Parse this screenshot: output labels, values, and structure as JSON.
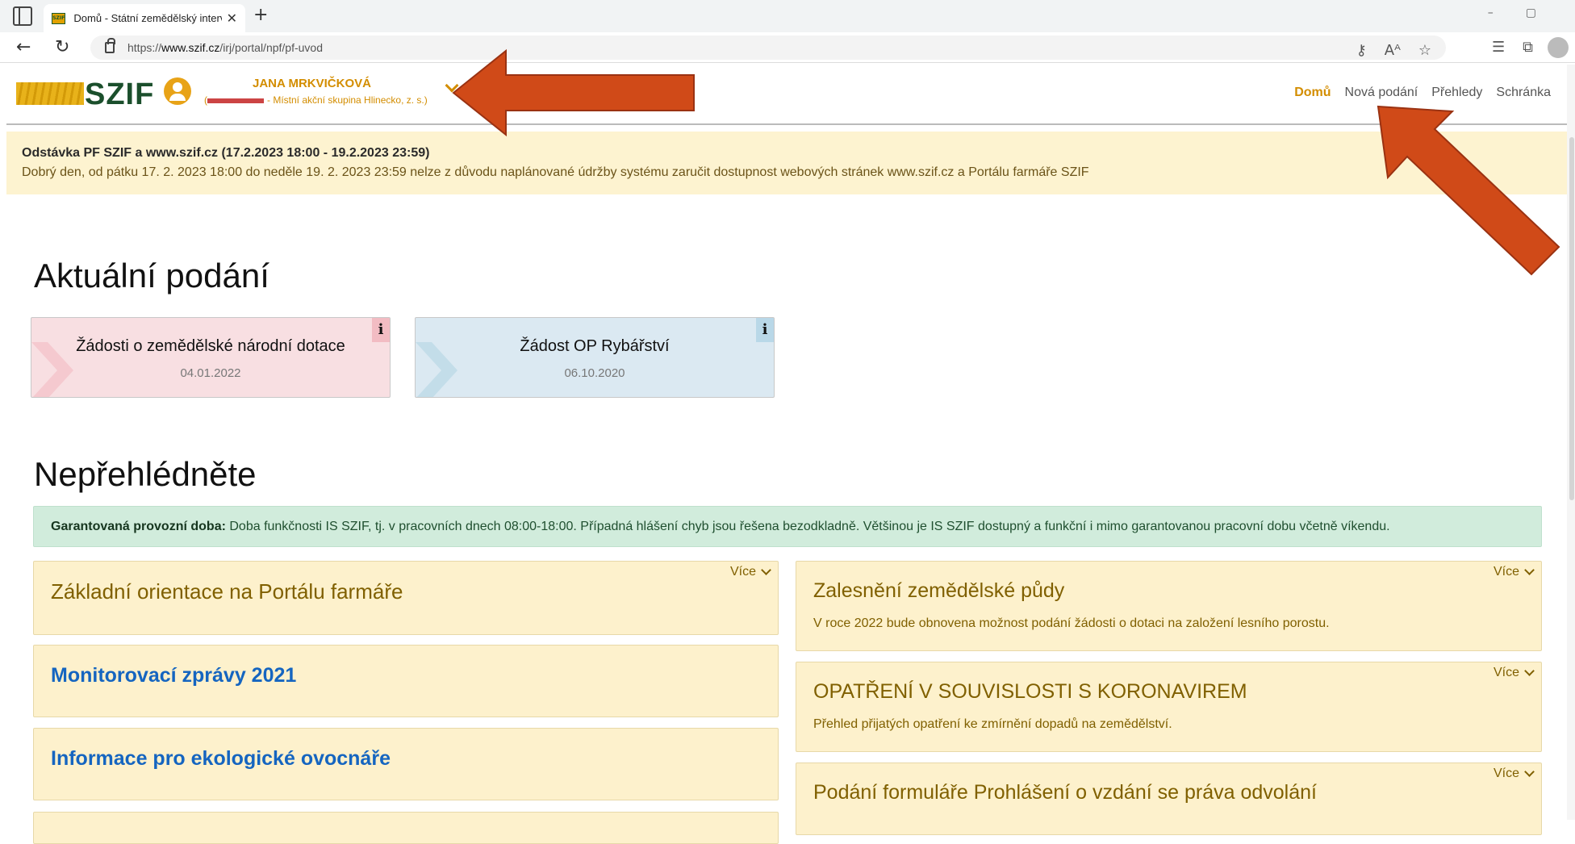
{
  "browser": {
    "tab_title": "Domů - Státní zemědělský interv",
    "favicon_text": "SZIF",
    "url_prefix": "https://",
    "url_host": "www.szif.cz",
    "url_path": "/irj/portal/npf/pf-uvod"
  },
  "header": {
    "logo_text": "SZIF",
    "user_name": "JANA MRKVIČKOVÁ",
    "user_org": "- Místní akční skupina Hlinecko, z. s.)",
    "user_org_open": "(",
    "nav": [
      "Domů",
      "Nová podání",
      "Přehledy",
      "Schránka"
    ]
  },
  "notice": {
    "title": "Odstávka PF SZIF a www.szif.cz (17.2.2023 18:00 - 19.2.2023 23:59)",
    "body": "Dobrý den, od pátku 17. 2. 2023 18:00 do neděle 19. 2. 2023 23:59 nelze z důvodu naplánované údržby systému zaručit dostupnost webových stránek www.szif.cz a Portálu farmáře SZIF"
  },
  "current": {
    "heading": "Aktuální podání",
    "cards": [
      {
        "title": "Žádosti o zemědělské národní dotace",
        "date": "04.01.2022",
        "info": "i"
      },
      {
        "title": "Žádost OP Rybářství",
        "date": "06.10.2020",
        "info": "i"
      }
    ]
  },
  "dontmiss": {
    "heading": "Nepřehlédněte",
    "banner_bold": "Garantovaná provozní doba:",
    "banner_text": " Doba funkčnosti IS SZIF, tj. v pracovních dnech 08:00-18:00. Případná hlášení chyb jsou řešena bezodkladně. Většinou je IS SZIF dostupný a funkční i mimo garantovanou pracovní dobu včetně víkendu.",
    "more_label": "Více",
    "left_panels": [
      {
        "title": "Základní orientace na Portálu farmáře"
      },
      {
        "title": "Monitorovací zprávy 2021"
      },
      {
        "title": "Informace pro ekologické ovocnáře"
      }
    ],
    "right_panels": [
      {
        "title": "Zalesnění zemědělské půdy",
        "desc": "V roce 2022 bude obnovena možnost podání žádosti o dotaci na založení lesního porostu."
      },
      {
        "title": "OPATŘENÍ V SOUVISLOSTI S KORONAVIREM",
        "desc": "Přehled přijatých opatření ke zmírnění dopadů na zemědělství."
      },
      {
        "title": "Podání formuláře Prohlášení o vzdání se práva odvolání"
      }
    ]
  },
  "colors": {
    "accent": "#d38d00",
    "brand_green": "#1b4f2c",
    "arrow": "#d04a18"
  }
}
